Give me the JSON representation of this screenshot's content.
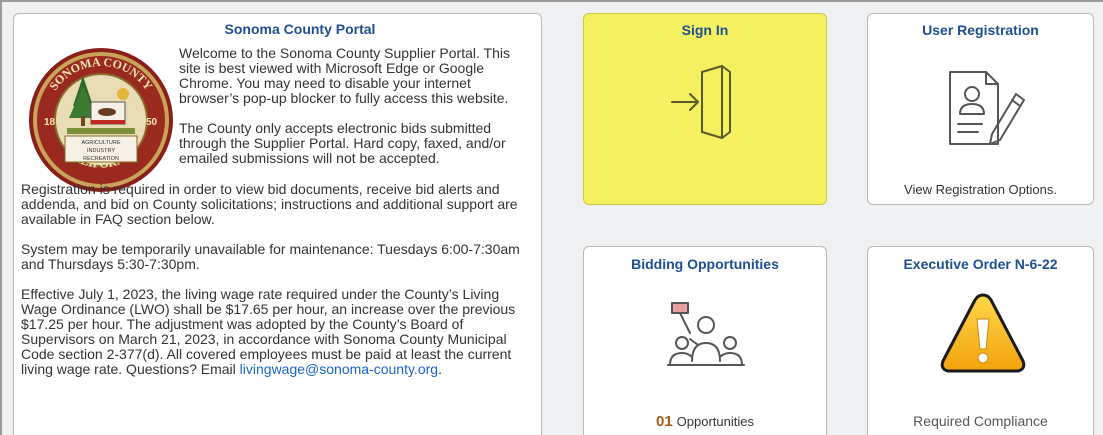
{
  "portal": {
    "title": "Sonoma County Portal",
    "intro_1": "Welcome to the Sonoma County Supplier Portal. This site is best viewed with Microsoft Edge or Google Chrome. You may need to disable your internet browser’s pop-up blocker to fully access this website.",
    "intro_2": "The County only accepts electronic bids submitted through the Supplier Portal. Hard copy, faxed, and/or emailed submissions will not be accepted.",
    "para_registration": "Registration is required in order to view bid documents, receive bid alerts and addenda, and bid on County solicitations; instructions and additional support are available in FAQ section below.",
    "para_maintenance": "System may be temporarily unavailable for maintenance: Tuesdays 6:00-7:30am and Thursdays 5:30-7:30pm.",
    "para_wage": "Effective July 1, 2023, the living wage rate required under the County’s Living Wage Ordinance (LWO) shall be $17.65 per hour, an increase over the previous $17.25 per hour. The adjustment was adopted by the County’s Board of Supervisors on March 21, 2023, in accordance with Sonoma County Municipal Code section 2-377(d). All covered employees must be paid at least the current living wage rate. Questions? Email ",
    "email": "livingwage@sonoma-county.org",
    "period": ".",
    "seal": {
      "top_text": "SONOMA COUNTY",
      "bottom_text": "CALIFORNIA",
      "year_left": "18",
      "year_right": "50",
      "banner_1": "AGRICULTURE",
      "banner_2": "INDUSTRY",
      "banner_3": "RECREATION"
    }
  },
  "signin": {
    "title": "Sign In",
    "icon": "sign-in-door-icon"
  },
  "registration": {
    "title": "User Registration",
    "caption": "View Registration Options.",
    "icon": "registration-form-icon"
  },
  "bidding": {
    "title": "Bidding Opportunities",
    "count": "01",
    "caption": "Opportunities",
    "icon": "bidding-crowd-icon"
  },
  "executive_order": {
    "title": "Executive Order N-6-22",
    "caption": "Required Compliance",
    "icon": "warning-icon"
  },
  "colors": {
    "title_blue": "#1f4e91",
    "signin_yellow": "#f5f060",
    "link_blue": "#1a63c8",
    "count_brown": "#a15c14"
  }
}
